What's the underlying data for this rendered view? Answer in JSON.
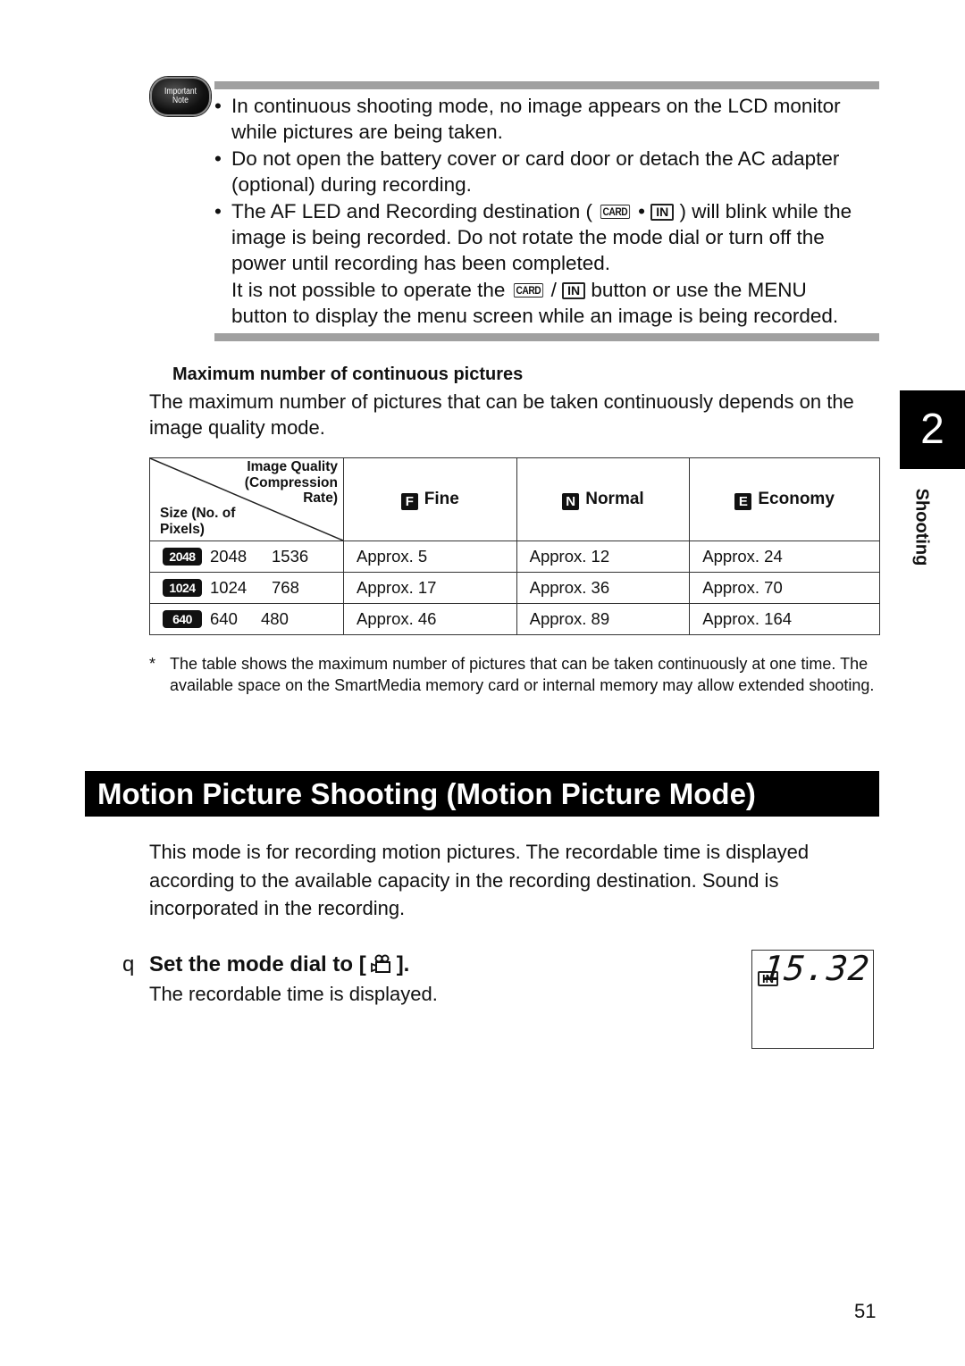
{
  "important_note": {
    "badge_line1": "Important",
    "badge_line2": "Note",
    "bullets": [
      {
        "text": "In continuous shooting mode, no image appears on the LCD monitor",
        "cont": "while pictures are being taken."
      },
      {
        "text": "Do not open the battery cover or card door or detach the AC adapter",
        "cont": "(optional) during recording."
      }
    ],
    "bullet3": {
      "pre": "The AF LED and Recording destination ( ",
      "card": "CARD",
      "sep": " • ",
      "in": "IN",
      "post": " ) will blink while the",
      "line2": "image is being recorded. Do not rotate the mode dial or turn off the",
      "line3": "power until recording has been completed.",
      "line4_pre": "It is not possible to operate the ",
      "line4_card": "CARD",
      "line4_sep": " / ",
      "line4_in": "IN",
      "line4_post": " button or use the MENU",
      "line5": "button to display the menu screen while an image is being recorded."
    },
    "bullet_char": "•"
  },
  "max_pictures": {
    "heading": "Maximum number of continuous pictures",
    "intro": "The maximum number of pictures that can be taken continuously depends on the image quality mode.",
    "table": {
      "corner_top": [
        "Image Quality",
        "(Compression",
        "Rate)"
      ],
      "corner_bottom": [
        "Size (No. of",
        "Pixels)"
      ],
      "columns": [
        {
          "icon": "F",
          "label": "Fine"
        },
        {
          "icon": "N",
          "label": "Normal"
        },
        {
          "icon": "E",
          "label": "Economy"
        }
      ],
      "rows": [
        {
          "badge": "2048",
          "width": "2048",
          "height": "1536",
          "values": [
            "Approx. 5",
            "Approx. 12",
            "Approx. 24"
          ]
        },
        {
          "badge": "1024",
          "width": "1024",
          "height": "768",
          "values": [
            "Approx. 17",
            "Approx. 36",
            "Approx. 70"
          ]
        },
        {
          "badge": "640",
          "width": "640",
          "height": "480",
          "values": [
            "Approx. 46",
            "Approx. 89",
            "Approx. 164"
          ]
        }
      ]
    },
    "footnote_mark": "*",
    "footnote": "The table shows the maximum number of pictures that can be taken continuously at one time. The available space on the SmartMedia memory card or internal memory may allow extended shooting."
  },
  "side_tab": {
    "chapter": "2",
    "label": "Shooting"
  },
  "section": {
    "title": "Motion Picture Shooting (Motion Picture Mode)",
    "intro": "This mode is for recording motion pictures. The recordable time is displayed according to the available capacity in the recording destination. Sound is incorporated in the recording."
  },
  "step": {
    "number": "q",
    "heading_pre": "Set the mode dial to [",
    "heading_icon": "movie-camera-icon",
    "heading_post": "].",
    "sub": "The recordable time is displayed."
  },
  "lcd": {
    "destination": "IN",
    "time": "15.32"
  },
  "page_number": "51"
}
